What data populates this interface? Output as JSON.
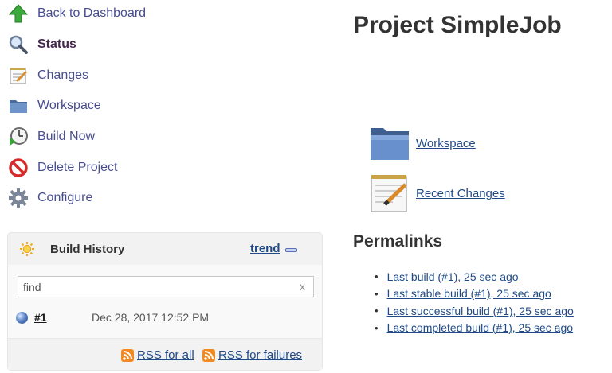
{
  "sidebar": {
    "items": [
      {
        "label": "Back to Dashboard",
        "icon": "up-arrow-icon"
      },
      {
        "label": "Status",
        "icon": "magnifier-icon"
      },
      {
        "label": "Changes",
        "icon": "notepad-icon"
      },
      {
        "label": "Workspace",
        "icon": "folder-icon"
      },
      {
        "label": "Build Now",
        "icon": "clock-play-icon"
      },
      {
        "label": "Delete Project",
        "icon": "no-entry-icon"
      },
      {
        "label": "Configure",
        "icon": "gear-icon"
      }
    ]
  },
  "build_history": {
    "title": "Build History",
    "trend_label": "trend",
    "search": {
      "value": "find",
      "clear": "x"
    },
    "builds": [
      {
        "number": "#1",
        "date": "Dec 28, 2017 12:52 PM"
      }
    ],
    "rss_all": "RSS for all",
    "rss_failures": "RSS for failures"
  },
  "main": {
    "title": "Project SimpleJob",
    "links": [
      {
        "label": "Workspace",
        "icon": "folder-icon"
      },
      {
        "label": "Recent Changes",
        "icon": "notepad-icon"
      }
    ],
    "permalinks_title": "Permalinks",
    "permalinks": [
      "Last build (#1), 25 sec ago",
      "Last stable build (#1), 25 sec ago",
      "Last successful build (#1), 25 sec ago",
      "Last completed build (#1), 25 sec ago"
    ]
  },
  "colors": {
    "link": "#204a87",
    "sidebar_link": "#474d8f",
    "rss": "#f28a22"
  }
}
